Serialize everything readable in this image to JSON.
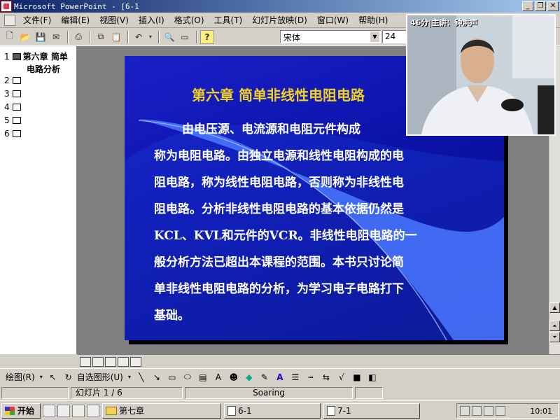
{
  "window": {
    "title": "Microsoft PowerPoint - [6-1"
  },
  "menu": [
    "文件(F)",
    "编辑(E)",
    "视图(V)",
    "插入(I)",
    "格式(O)",
    "工具(T)",
    "幻灯片放映(D)",
    "窗口(W)",
    "帮助(H)"
  ],
  "toolbar": {
    "font": "宋体",
    "size": "24"
  },
  "outline": {
    "slides": [
      {
        "num": "1",
        "title_line1": "第六章 简单",
        "title_line2": "电路分析"
      },
      {
        "num": "2"
      },
      {
        "num": "3"
      },
      {
        "num": "4"
      },
      {
        "num": "5"
      },
      {
        "num": "6"
      }
    ]
  },
  "slide": {
    "title": "第六章  简单非线性电阻电路",
    "lines": [
      "由电压源、电流源和电阻元件构成",
      "称为电阻电路。由独立电源和线性电阻构成的电",
      "阻电路，称为线性电阻电路，否则称为非线性电",
      "阻电路。分析非线性电阻电路的基本依据仍然是",
      "KCL、KVL和元件的VCR。非线性电阻电路的一",
      "般分析方法已超出本课程的范围。本书只讨论简",
      "单非线性电阻电路的分析，为学习电子电路打下",
      "基础。"
    ]
  },
  "video": {
    "caption": "46分|主讲：钟洪声"
  },
  "drawbar": {
    "draw_label": "绘图(R)",
    "autoshape_label": "自选图形(U)"
  },
  "status": {
    "slide": "幻灯片 1 / 6",
    "design": "Soaring"
  },
  "taskbar": {
    "start": "开始",
    "tasks": [
      "第七章",
      "6-1",
      "7-1"
    ],
    "clock": "10:01"
  }
}
